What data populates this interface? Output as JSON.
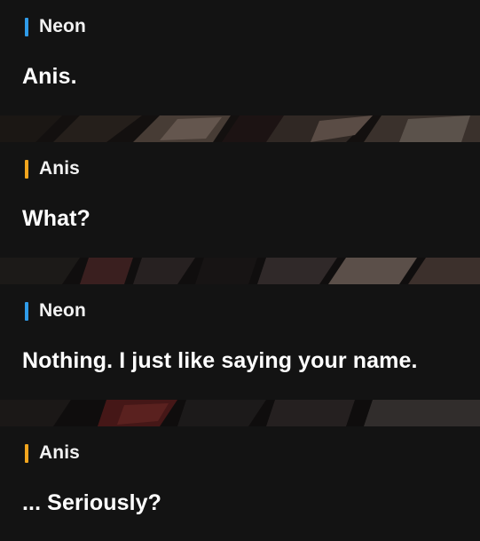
{
  "colors": {
    "background": "#131313",
    "text": "#ffffff",
    "neon_accent": "#2f9be8",
    "anis_accent": "#f2a51e"
  },
  "dialogue": [
    {
      "speaker": "Neon",
      "accent": "#2f9be8",
      "text": "Anis."
    },
    {
      "speaker": "Anis",
      "accent": "#f2a51e",
      "text": "What?"
    },
    {
      "speaker": "Neon",
      "accent": "#2f9be8",
      "text": "Nothing. I just like saying your name."
    },
    {
      "speaker": "Anis",
      "accent": "#f2a51e",
      "text": "... Seriously?"
    }
  ]
}
